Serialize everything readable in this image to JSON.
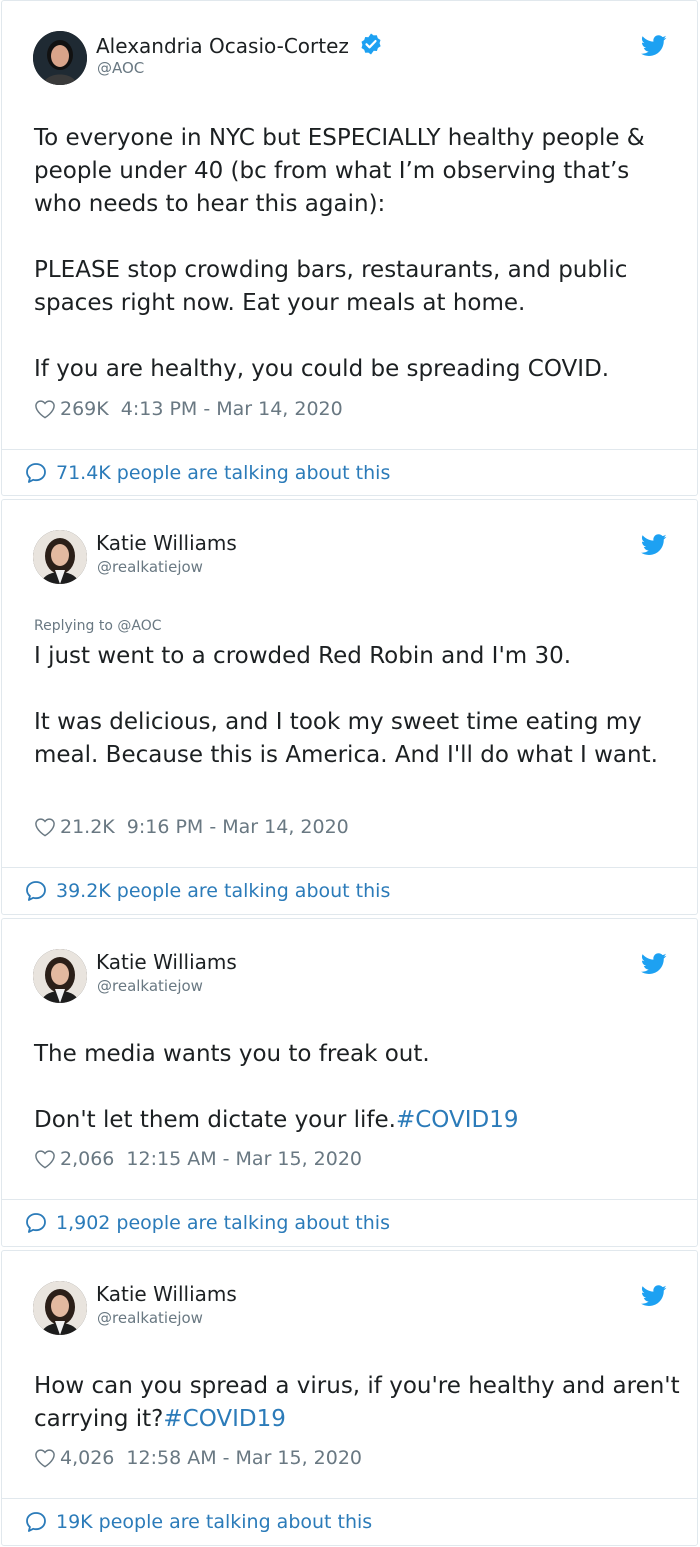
{
  "tweets": [
    {
      "author_name": "Alexandria Ocasio-Cortez",
      "handle": "@AOC",
      "verified": true,
      "replying_to": "",
      "body": [
        "To everyone in NYC but ESPECIALLY healthy people & people under 40 (bc from what I’m observing that’s who needs to hear this again):",
        "PLEASE stop crowding bars, restaurants, and public spaces right now. Eat your meals at home.",
        "If you are healthy, you could be spreading COVID."
      ],
      "likes": "269K",
      "timestamp": "4:13 PM - Mar 14, 2020",
      "talking": "71.4K people are talking about this"
    },
    {
      "author_name": "Katie Williams",
      "handle": "@realkatiejow",
      "verified": false,
      "replying_to": "Replying to @AOC",
      "body": [
        "I just went to a crowded Red Robin and I'm 30.",
        "It was delicious, and I took my sweet time eating my meal. Because this is America. And I'll do what I want."
      ],
      "likes": "21.2K",
      "timestamp": "9:16 PM - Mar 14, 2020",
      "talking": "39.2K people are talking about this"
    },
    {
      "author_name": "Katie Williams",
      "handle": "@realkatiejow",
      "verified": false,
      "replying_to": "",
      "body": [
        "The media wants you to freak out.",
        "Don't let them dictate your life."
      ],
      "hashtag": "#COVID19",
      "likes": "2,066",
      "timestamp": "12:15 AM - Mar 15, 2020",
      "talking": "1,902 people are talking about this"
    },
    {
      "author_name": "Katie Williams",
      "handle": "@realkatiejow",
      "verified": false,
      "replying_to": "",
      "body": [
        "How can you spread a virus, if you're healthy and aren't carrying it?"
      ],
      "hashtag": "#COVID19",
      "likes": "4,026",
      "timestamp": "12:58 AM - Mar 15, 2020",
      "talking": "19K people are talking about this"
    }
  ],
  "colors": {
    "link": "#2b7bb9",
    "twitter_blue": "#1da1f2",
    "muted": "#697882",
    "border": "#e1e8ed"
  },
  "icons": {
    "verified": "verified-badge-icon",
    "bird": "twitter-bird-icon",
    "heart": "heart-icon",
    "bubble": "speech-bubble-icon"
  }
}
